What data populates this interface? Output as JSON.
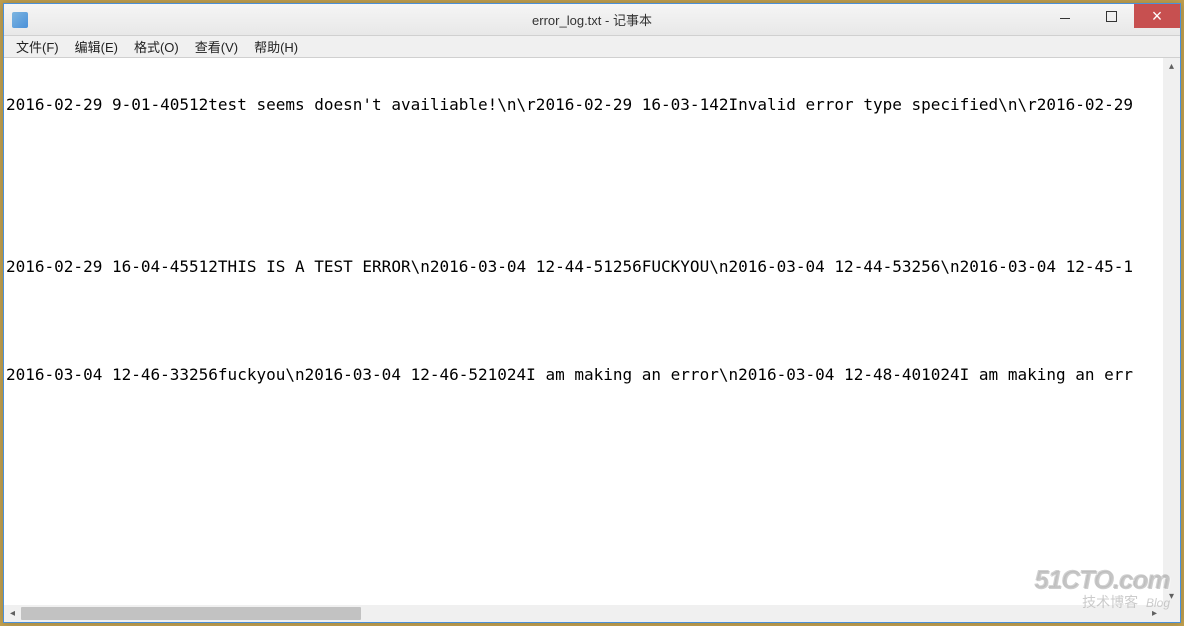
{
  "window": {
    "title": "error_log.txt - 记事本"
  },
  "menubar": {
    "file": "文件(F)",
    "edit": "编辑(E)",
    "format": "格式(O)",
    "view": "查看(V)",
    "help": "帮助(H)"
  },
  "content": {
    "line1": "2016-02-29 9-01-40512test seems doesn't availiable!\\n\\r2016-02-29 16-03-142Invalid error type specified\\n\\r2016-02-29",
    "line2": "2016-02-29 16-04-45512THIS IS A TEST ERROR\\n2016-03-04 12-44-51256FUCKYOU\\n2016-03-04 12-44-53256\\n2016-03-04 12-45-1",
    "line3": "2016-03-04 12-46-33256fuckyou\\n2016-03-04 12-46-521024I am making an error\\n2016-03-04 12-48-401024I am making an err"
  },
  "watermark": {
    "main": "51CTO.com",
    "sub_text": "技术博客",
    "sub_blog": "Blog"
  }
}
